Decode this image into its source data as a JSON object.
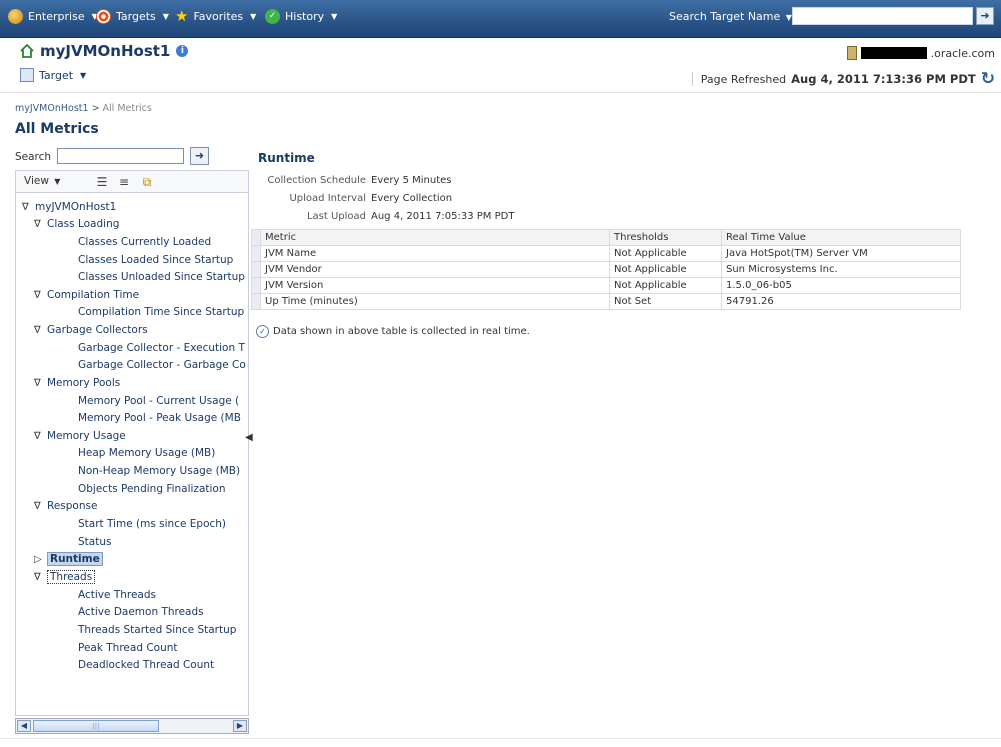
{
  "nav": {
    "enterprise": "Enterprise",
    "targets": "Targets",
    "favorites": "Favorites",
    "history": "History",
    "search_label": "Search Target Name",
    "search_value": ""
  },
  "header": {
    "title": "myJVMOnHost1",
    "target_menu": "Target",
    "host_suffix": ".oracle.com",
    "refresh_label": "Page Refreshed",
    "refresh_time": "Aug 4, 2011 7:13:36 PM PDT"
  },
  "breadcrumb": {
    "link": "myJVMOnHost1",
    "separator": " > ",
    "current": "All Metrics"
  },
  "page_heading": "All Metrics",
  "left": {
    "search_label": "Search",
    "view_label": "View",
    "tree": [
      {
        "label": "myJVMOnHost1",
        "level": 0,
        "toggle": "∇"
      },
      {
        "label": "Class Loading",
        "level": 1,
        "toggle": "∇"
      },
      {
        "label": "Classes Currently Loaded",
        "level": 2,
        "toggle": ""
      },
      {
        "label": "Classes Loaded Since Startup",
        "level": 2,
        "toggle": ""
      },
      {
        "label": "Classes Unloaded Since Startup",
        "level": 2,
        "toggle": ""
      },
      {
        "label": "Compilation Time",
        "level": 1,
        "toggle": "∇"
      },
      {
        "label": "Compilation Time Since Startup",
        "level": 2,
        "toggle": ""
      },
      {
        "label": "Garbage Collectors",
        "level": 1,
        "toggle": "∇"
      },
      {
        "label": "Garbage Collector - Execution T",
        "level": 2,
        "toggle": ""
      },
      {
        "label": "Garbage Collector - Garbage Co",
        "level": 2,
        "toggle": ""
      },
      {
        "label": "Memory Pools",
        "level": 1,
        "toggle": "∇"
      },
      {
        "label": "Memory Pool - Current Usage (",
        "level": 2,
        "toggle": ""
      },
      {
        "label": "Memory Pool - Peak Usage (MB",
        "level": 2,
        "toggle": ""
      },
      {
        "label": "Memory Usage",
        "level": 1,
        "toggle": "∇"
      },
      {
        "label": "Heap Memory Usage (MB)",
        "level": 2,
        "toggle": ""
      },
      {
        "label": "Non-Heap Memory Usage (MB)",
        "level": 2,
        "toggle": ""
      },
      {
        "label": "Objects Pending Finalization",
        "level": 2,
        "toggle": ""
      },
      {
        "label": "Response",
        "level": 1,
        "toggle": "∇"
      },
      {
        "label": "Start Time (ms since Epoch)",
        "level": 2,
        "toggle": ""
      },
      {
        "label": "Status",
        "level": 2,
        "toggle": ""
      },
      {
        "label": "Runtime",
        "level": 1,
        "toggle": "▷",
        "selected": true
      },
      {
        "label": "Threads",
        "level": 1,
        "toggle": "∇",
        "focused": true
      },
      {
        "label": "Active Threads",
        "level": 2,
        "toggle": ""
      },
      {
        "label": "Active Daemon Threads",
        "level": 2,
        "toggle": ""
      },
      {
        "label": "Threads Started Since Startup",
        "level": 2,
        "toggle": ""
      },
      {
        "label": "Peak Thread Count",
        "level": 2,
        "toggle": ""
      },
      {
        "label": "Deadlocked Thread Count",
        "level": 2,
        "toggle": ""
      }
    ]
  },
  "main": {
    "title": "Runtime",
    "details": [
      {
        "key": "Collection Schedule",
        "value": "Every 5 Minutes"
      },
      {
        "key": "Upload Interval",
        "value": "Every Collection"
      },
      {
        "key": "Last Upload",
        "value": "Aug 4, 2011 7:05:33 PM PDT"
      }
    ],
    "columns": [
      "Metric",
      "Thresholds",
      "Real Time Value"
    ],
    "rows": [
      [
        "JVM Name",
        "Not Applicable",
        "Java HotSpot(TM) Server VM"
      ],
      [
        "JVM Vendor",
        "Not Applicable",
        "Sun Microsystems Inc."
      ],
      [
        "JVM Version",
        "Not Applicable",
        "1.5.0_06-b05"
      ],
      [
        "Up Time (minutes)",
        "Not Set",
        "54791.26"
      ]
    ],
    "note": "Data shown in above table is collected in real time."
  },
  "icons": {
    "enterprise": "enterprise-icon",
    "targets": "targets-icon",
    "favorites": "star-icon",
    "history": "history-icon",
    "home": "home-icon",
    "refresh": "refresh-icon"
  },
  "colors": {
    "nav_bg": "#2a5487",
    "heading": "#1b3a66",
    "selected_bg": "#c5d6ec"
  }
}
